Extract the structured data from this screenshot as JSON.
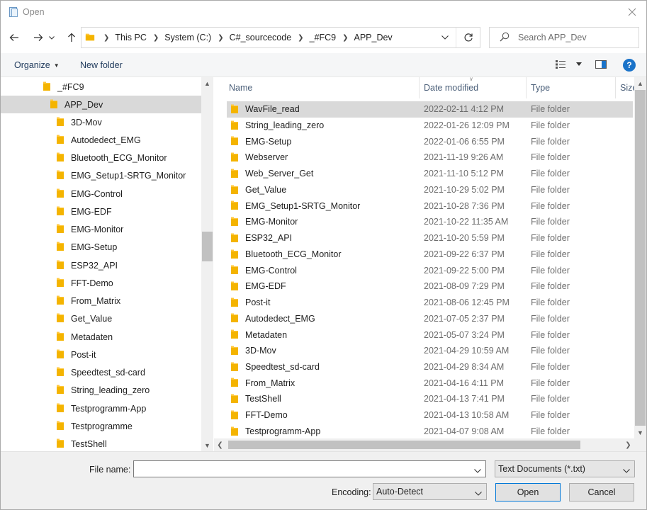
{
  "window": {
    "title": "Open"
  },
  "address": {
    "crumbs": [
      "This PC",
      "System (C:)",
      "C#_sourcecode",
      "_#FC9",
      "APP_Dev"
    ]
  },
  "search": {
    "placeholder": "Search APP_Dev"
  },
  "toolbar": {
    "organize": "Organize",
    "new_folder": "New folder",
    "help": "?"
  },
  "nav": {
    "parent": "_#FC9",
    "current": "APP_Dev",
    "children": [
      "3D-Mov",
      "Autodedect_EMG",
      "Bluetooth_ECG_Monitor",
      "EMG_Setup1-SRTG_Monitor",
      "EMG-Control",
      "EMG-EDF",
      "EMG-Monitor",
      "EMG-Setup",
      "ESP32_API",
      "FFT-Demo",
      "From_Matrix",
      "Get_Value",
      "Metadaten",
      "Post-it",
      "Speedtest_sd-card",
      "String_leading_zero",
      "Testprogramm-App",
      "Testprogramme",
      "TestShell"
    ]
  },
  "columns": {
    "name": "Name",
    "date": "Date modified",
    "type": "Type",
    "size": "Size"
  },
  "files": [
    {
      "name": "WavFile_read",
      "date": "2022-02-11 4:12 PM",
      "type": "File folder"
    },
    {
      "name": "String_leading_zero",
      "date": "2022-01-26 12:09 PM",
      "type": "File folder"
    },
    {
      "name": "EMG-Setup",
      "date": "2022-01-06 6:55 PM",
      "type": "File folder"
    },
    {
      "name": "Webserver",
      "date": "2021-11-19 9:26 AM",
      "type": "File folder"
    },
    {
      "name": "Web_Server_Get",
      "date": "2021-11-10 5:12 PM",
      "type": "File folder"
    },
    {
      "name": "Get_Value",
      "date": "2021-10-29 5:02 PM",
      "type": "File folder"
    },
    {
      "name": "EMG_Setup1-SRTG_Monitor",
      "date": "2021-10-28 7:36 PM",
      "type": "File folder"
    },
    {
      "name": "EMG-Monitor",
      "date": "2021-10-22 11:35 AM",
      "type": "File folder"
    },
    {
      "name": "ESP32_API",
      "date": "2021-10-20 5:59 PM",
      "type": "File folder"
    },
    {
      "name": "Bluetooth_ECG_Monitor",
      "date": "2021-09-22 6:37 PM",
      "type": "File folder"
    },
    {
      "name": "EMG-Control",
      "date": "2021-09-22 5:00 PM",
      "type": "File folder"
    },
    {
      "name": "EMG-EDF",
      "date": "2021-08-09 7:29 PM",
      "type": "File folder"
    },
    {
      "name": "Post-it",
      "date": "2021-08-06 12:45 PM",
      "type": "File folder"
    },
    {
      "name": "Autodedect_EMG",
      "date": "2021-07-05 2:37 PM",
      "type": "File folder"
    },
    {
      "name": "Metadaten",
      "date": "2021-05-07 3:24 PM",
      "type": "File folder"
    },
    {
      "name": "3D-Mov",
      "date": "2021-04-29 10:59 AM",
      "type": "File folder"
    },
    {
      "name": "Speedtest_sd-card",
      "date": "2021-04-29 8:34 AM",
      "type": "File folder"
    },
    {
      "name": "From_Matrix",
      "date": "2021-04-16 4:11 PM",
      "type": "File folder"
    },
    {
      "name": "TestShell",
      "date": "2021-04-13 7:41 PM",
      "type": "File folder"
    },
    {
      "name": "FFT-Demo",
      "date": "2021-04-13 10:58 AM",
      "type": "File folder"
    },
    {
      "name": "Testprogramm-App",
      "date": "2021-04-07 9:08 AM",
      "type": "File folder"
    }
  ],
  "bottom": {
    "file_name_label": "File name:",
    "file_name_value": "",
    "filter": "Text Documents (*.txt)",
    "encoding_label": "Encoding:",
    "encoding": "Auto-Detect",
    "open": "Open",
    "cancel": "Cancel"
  },
  "colors": {
    "folder": "#ffc83d",
    "accent": "#0078d7",
    "help": "#1a73c9",
    "selection": "#d9d9d9"
  },
  "icons": {
    "folder": "folder-icon",
    "back": "back-arrow-icon",
    "forward": "forward-arrow-icon",
    "up": "up-arrow-icon",
    "refresh": "refresh-icon",
    "search": "search-icon",
    "close": "close-icon"
  }
}
